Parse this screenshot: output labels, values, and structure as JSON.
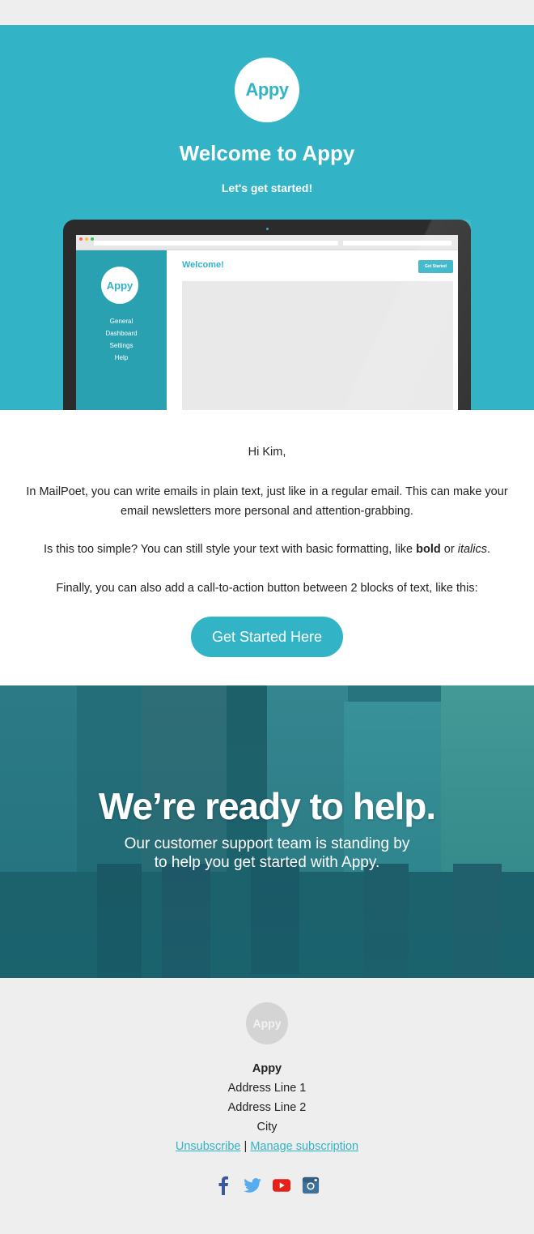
{
  "hero": {
    "logo_text": "Appy",
    "title": "Welcome to Appy",
    "subtitle": "Let's get started!",
    "mockup": {
      "logo_text": "Appy",
      "nav": [
        "General",
        "Dashboard",
        "Settings",
        "Help"
      ],
      "welcome": "Welcome!",
      "button": "Get Started"
    }
  },
  "body": {
    "greeting": "Hi Kim,",
    "para1": "In MailPoet, you can write emails in plain text, just like in a regular email. This can make your email newsletters more personal and attention-grabbing.",
    "para2_prefix": "Is this too simple? You can still style your text with basic formatting, like ",
    "para2_bold": "bold",
    "para2_middle": " or ",
    "para2_italic": "italics",
    "para2_suffix": ".",
    "para3": "Finally, you can also add a call-to-action button between 2 blocks of text, like this:",
    "cta": "Get Started Here"
  },
  "help": {
    "title": "We’re ready to help.",
    "line1": "Our customer support team is standing by",
    "line2": "to help you get started with Appy."
  },
  "footer": {
    "logo_text": "Appy",
    "org": "Appy",
    "address1": "Address Line 1",
    "address2": "Address Line 2",
    "city": "City",
    "unsubscribe": "Unsubscribe",
    "separator": "|",
    "manage": "Manage subscription",
    "social": [
      "facebook-icon",
      "twitter-icon",
      "youtube-icon",
      "instagram-icon"
    ]
  },
  "colors": {
    "brand": "#32b4c6",
    "facebook": "#3b5998",
    "twitter": "#55acee",
    "youtube": "#e62117",
    "instagram": "#3f729b"
  }
}
